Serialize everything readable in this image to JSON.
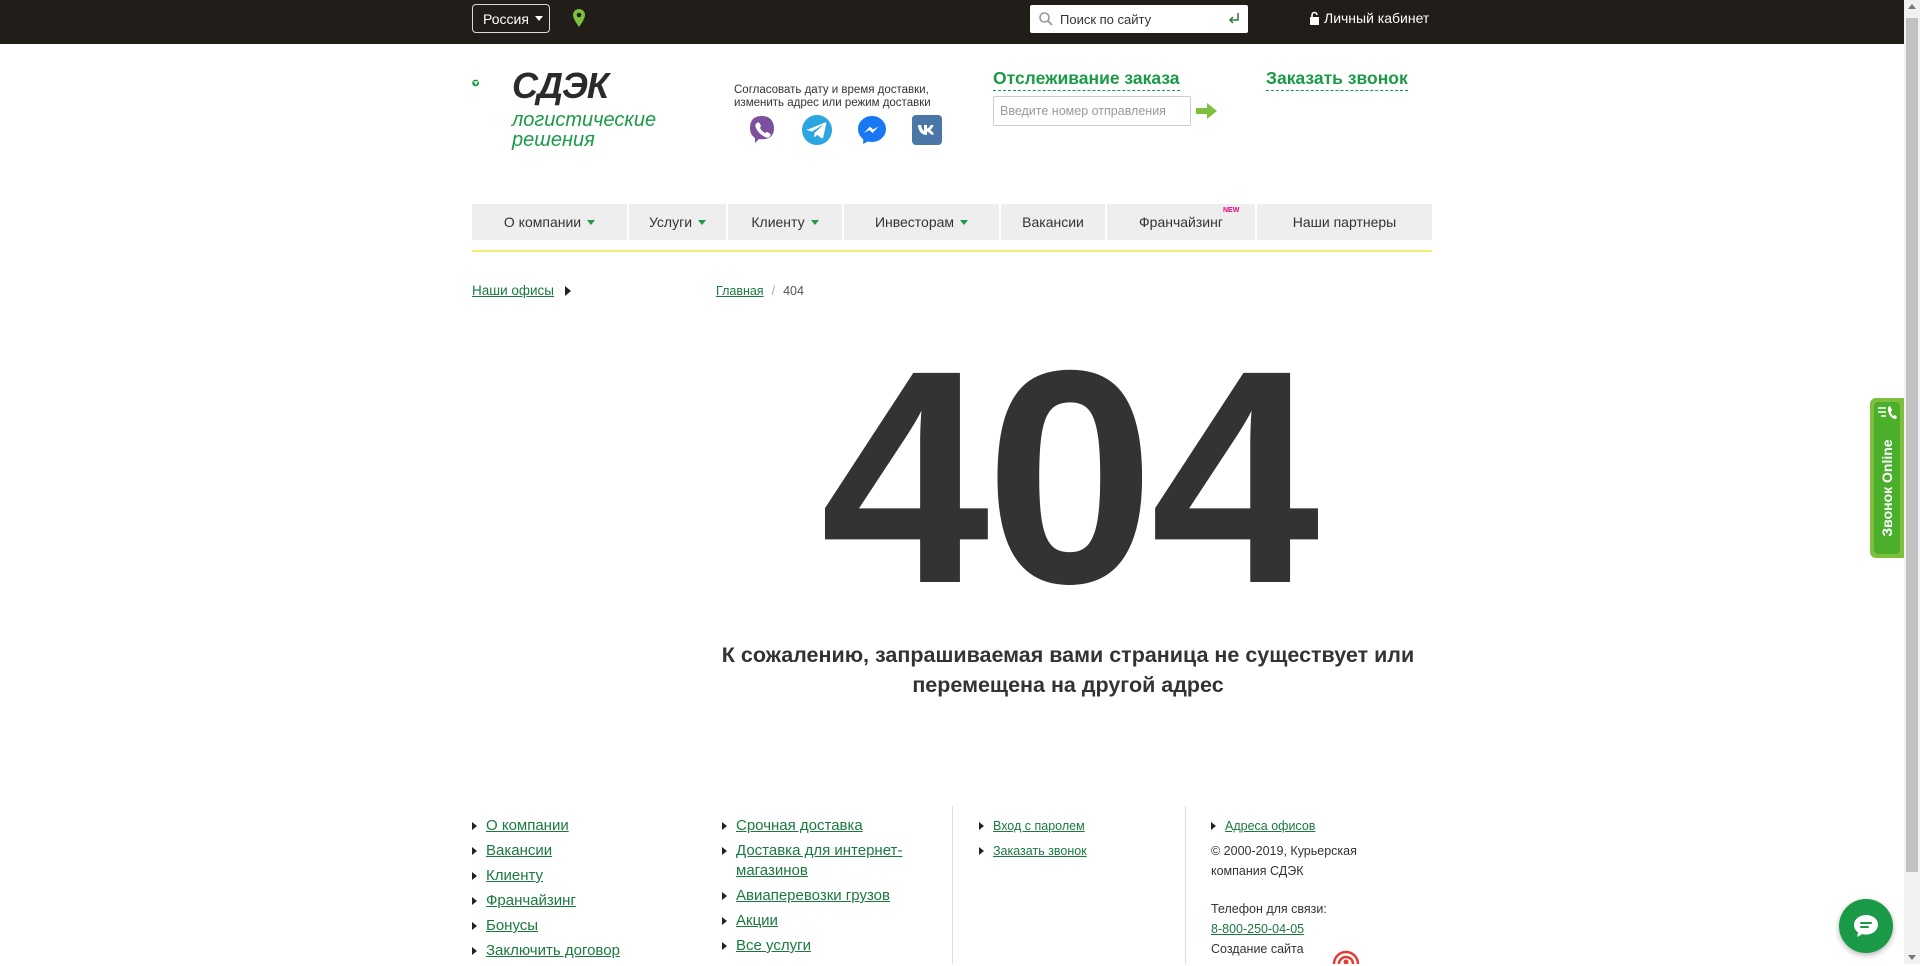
{
  "topbar": {
    "country": "Россия",
    "search_placeholder": "Поиск по сайту",
    "cabinet": "Личный кабинет"
  },
  "header": {
    "logo_text": "СДЭК",
    "slogan_line1": "логистические",
    "slogan_line2": "решения",
    "messengers_note": "Согласовать дату и время доставки, изменить адрес или режим доставки",
    "messengers": [
      "viber-icon",
      "telegram-icon",
      "messenger-icon",
      "vk-icon"
    ],
    "tracking_title": "Отслеживание заказа",
    "tracking_placeholder": "Введите номер отправления",
    "call_title": "Заказать звонок"
  },
  "nav": {
    "items": [
      {
        "label": "О компании"
      },
      {
        "label": "Услуги"
      },
      {
        "label": "Клиенту"
      },
      {
        "label": "Инвесторам"
      },
      {
        "label": "Вакансии"
      },
      {
        "label": "Франчайзинг",
        "badge": "NEW"
      },
      {
        "label": "Наши партнеры"
      }
    ]
  },
  "breadcrumb": {
    "offices": "Наши офисы",
    "home": "Главная",
    "current": "404"
  },
  "error": {
    "code": "404",
    "message": "К сожалению, запрашиваемая вами страница не существует или перемещена на другой адрес"
  },
  "footer": {
    "col_a": [
      "О компании",
      "Вакансии",
      "Клиенту",
      "Франчайзинг",
      "Бонусы",
      "Заключить договор"
    ],
    "col_b": [
      "Срочная доставка",
      "Доставка для интернет-магазинов",
      "Авиаперевозки грузов",
      "Акции",
      "Все услуги"
    ],
    "col_c": [
      "Вход с паролем",
      "Заказать звонок"
    ],
    "col_d_link": "Адреса офисов",
    "copyright": "© 2000-2019, Курьерская компания СДЭК",
    "phone_label": "Телефон для связи:",
    "phone": "8-800-250-04-05",
    "site_creation": "Создание сайта"
  },
  "widgets": {
    "call_online": "Звонок Online"
  },
  "colors": {
    "brand_green": "#1a9a47",
    "topbar": "#211d19",
    "nav_bg": "#eeeeee",
    "badge_pink": "#e2007a",
    "widget_green": "#7ec03e"
  }
}
